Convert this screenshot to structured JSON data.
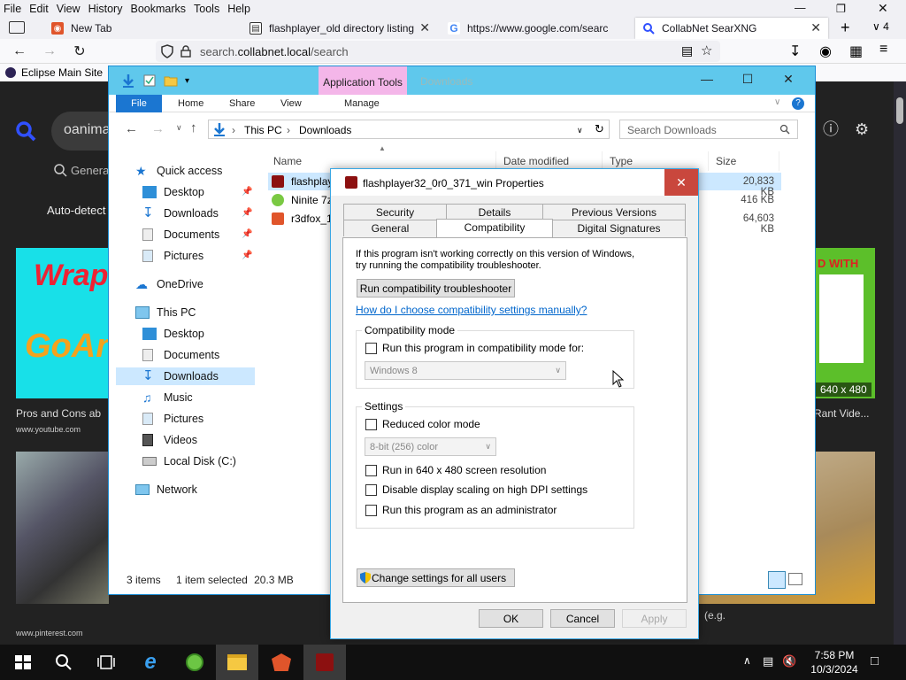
{
  "firefox": {
    "menu": [
      "File",
      "Edit",
      "View",
      "History",
      "Bookmarks",
      "Tools",
      "Help"
    ],
    "tabs": [
      {
        "title": "New Tab"
      },
      {
        "title": "flashplayer_old directory listing"
      },
      {
        "title": "https://www.google.com/searc"
      },
      {
        "title": "CollabNet SearXNG",
        "active": true
      }
    ],
    "tab_count": "4",
    "url_prefix": "search.",
    "url_domain": "collabnet.local",
    "url_path": "/search",
    "bookmark": "Eclipse Main Site"
  },
  "webpage": {
    "query": "oanima",
    "category": "Genera",
    "autodetect": "Auto-detect",
    "result1_title": "Pros and Cons ab",
    "result1_source": "www.youtube.com",
    "thumb1_top": "Wrap",
    "thumb1_bottom": "GoAn",
    "result2_source": "www.pinterest.com",
    "thumb3_text": "D WITH",
    "thumb3_res": "640 x 480",
    "result3_title": "Rant Vide...",
    "eg_text": "(e.g."
  },
  "explorer": {
    "app_tools": "Application Tools",
    "title_faded": "Downloads",
    "ribbon_tabs": [
      "File",
      "Home",
      "Share",
      "View",
      "Manage"
    ],
    "path": [
      "This PC",
      "Downloads"
    ],
    "search_placeholder": "Search Downloads",
    "columns": [
      "Name",
      "Date modified",
      "Type",
      "Size"
    ],
    "nav": {
      "quick_access": "Quick access",
      "quick_items": [
        "Desktop",
        "Downloads",
        "Documents",
        "Pictures"
      ],
      "onedrive": "OneDrive",
      "this_pc": "This PC",
      "pc_items": [
        "Desktop",
        "Documents",
        "Downloads",
        "Music",
        "Pictures",
        "Videos",
        "Local Disk (C:)"
      ],
      "network": "Network"
    },
    "files": [
      {
        "name": "flashplay",
        "size": "20,833 KB"
      },
      {
        "name": "Ninite 7z",
        "size": "416 KB"
      },
      {
        "name": "r3dfox_1",
        "size": "64,603 KB"
      }
    ],
    "status": {
      "items": "3 items",
      "selected": "1 item selected",
      "size": "20.3 MB"
    }
  },
  "dialog": {
    "title": "flashplayer32_0r0_371_win Properties",
    "tabs_row1": [
      "Security",
      "Details",
      "Previous Versions"
    ],
    "tabs_row2": [
      "General",
      "Compatibility",
      "Digital Signatures"
    ],
    "intro": "If this program isn't working correctly on this version of Windows, try running the compatibility troubleshooter.",
    "troubleshooter_button": "Run compatibility troubleshooter",
    "manual_link": "How do I choose compatibility settings manually?",
    "compat_group": "Compatibility mode",
    "compat_check": "Run this program in compatibility mode for:",
    "compat_os": "Windows 8",
    "settings_group": "Settings",
    "reduced_color": "Reduced color mode",
    "color_depth": "8-bit (256) color",
    "res_640": "Run in 640 x 480 screen resolution",
    "dpi": "Disable display scaling on high DPI settings",
    "admin": "Run this program as an administrator",
    "all_users_button": "Change settings for all users",
    "ok": "OK",
    "cancel": "Cancel",
    "apply": "Apply"
  },
  "taskbar": {
    "time": "7:58 PM",
    "date": "10/3/2024"
  },
  "colors": {
    "explorer_title": "#5fc8ec",
    "app_tools": "#f4b6e9",
    "file_tab": "#1b76d1",
    "close_red": "#c9473d",
    "link": "#0066cc"
  }
}
